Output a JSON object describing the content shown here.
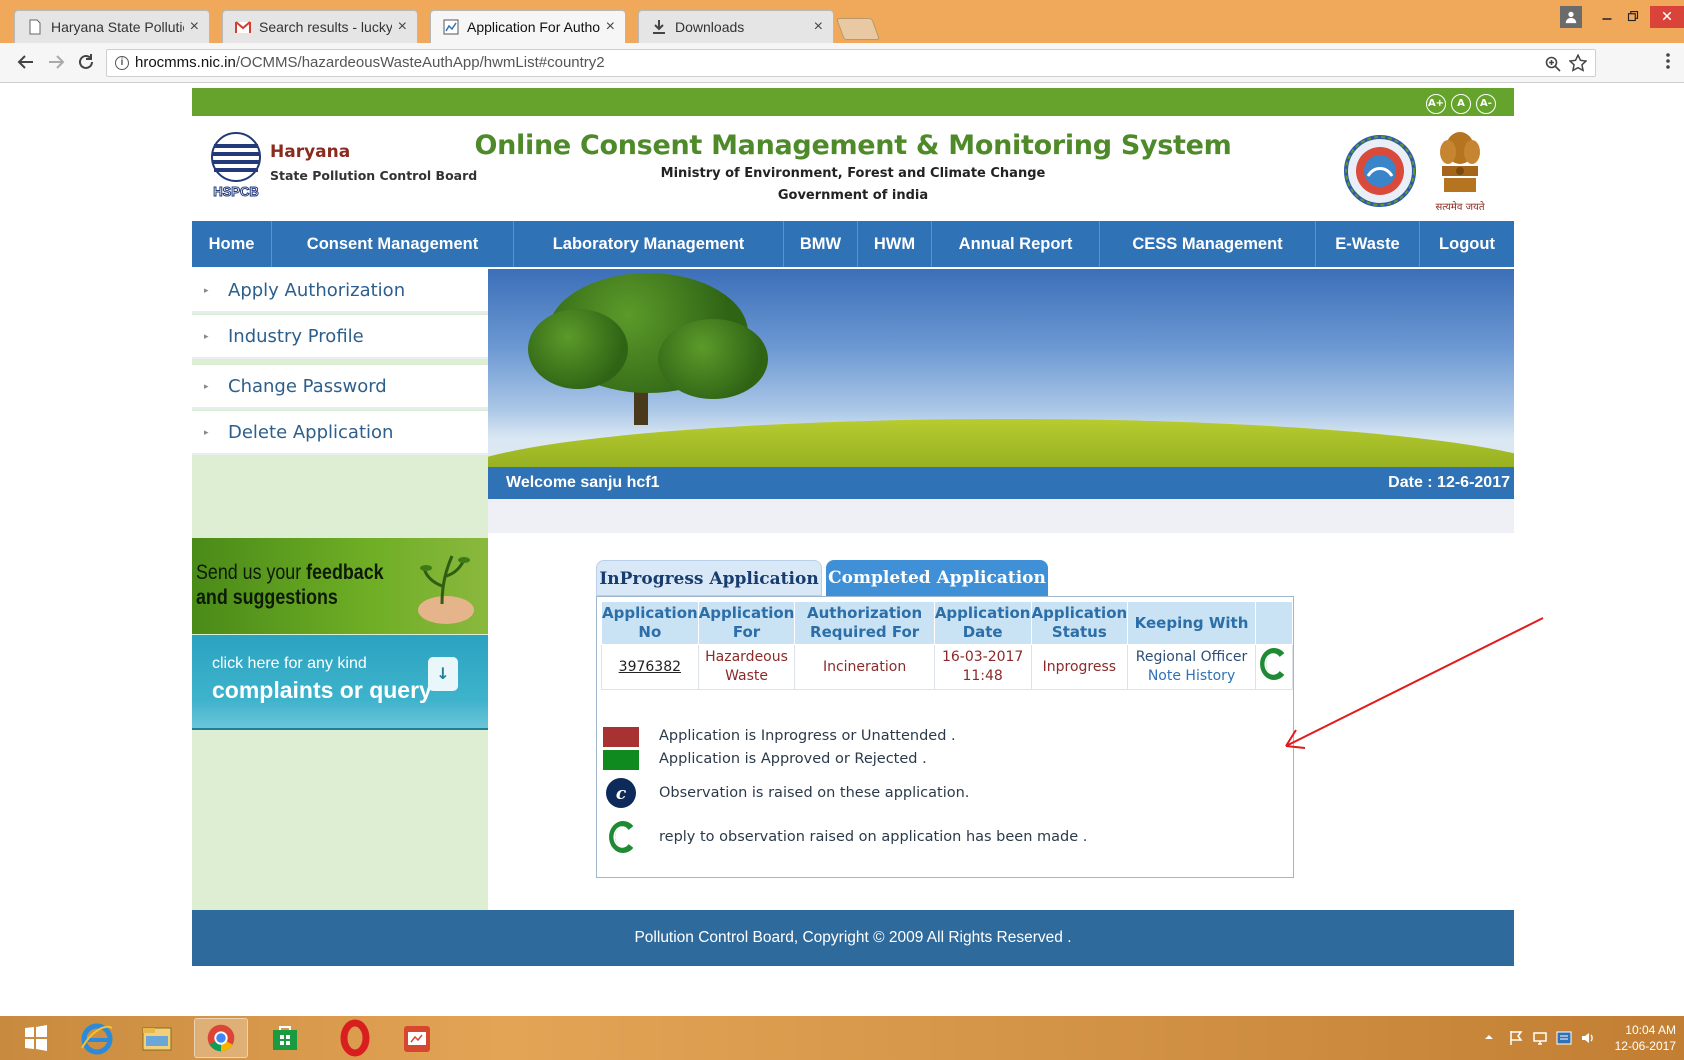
{
  "browser": {
    "tabs": [
      {
        "label": "Haryana State Pollution (",
        "favicon": "page-icon"
      },
      {
        "label": "Search results - luckysan",
        "favicon": "gmail-icon"
      },
      {
        "label": "Application For Authoriz",
        "favicon": "site-icon"
      },
      {
        "label": "Downloads",
        "favicon": "download-icon"
      }
    ],
    "close_glyph": "×",
    "url_host": "hrocmms.nic.in",
    "url_path": "/OCMMS/hazardeousWasteAuthApp/hwmList#country2"
  },
  "site": {
    "font_controls": [
      "A+",
      "A",
      "A-"
    ],
    "org_name": "Haryana",
    "org_sub": "State Pollution Control Board",
    "logo_caption": "HSPCB",
    "title": "Online Consent Management & Monitoring System",
    "ministry": "Ministry of Environment, Forest and Climate Change",
    "government": "Government of india",
    "emblem_caption": "सत्यमेव जयते"
  },
  "nav": [
    {
      "label": "Home"
    },
    {
      "label": "Consent Management"
    },
    {
      "label": "Laboratory Management"
    },
    {
      "label": "BMW"
    },
    {
      "label": "HWM"
    },
    {
      "label": "Annual Report"
    },
    {
      "label": "CESS Management"
    },
    {
      "label": "E-Waste"
    },
    {
      "label": "Logout"
    }
  ],
  "sidebar": {
    "items": [
      {
        "label": "Apply Authorization"
      },
      {
        "label": "Industry Profile"
      },
      {
        "label": "Change Password"
      },
      {
        "label": "Delete Application"
      }
    ],
    "feedback_line1_pre": "Send us your ",
    "feedback_line1_bold": "feedback",
    "feedback_line2": "and suggestions",
    "complaints_line1": "click here for any kind",
    "complaints_line2": "complaints or query"
  },
  "welcome": {
    "text": "Welcome sanju hcf1",
    "date": "Date : 12-6-2017"
  },
  "app_tabs": {
    "inprogress": "InProgress Application",
    "completed": "Completed Application"
  },
  "table": {
    "headers": [
      "Application No",
      "Application For",
      "Authorization Required For",
      "Application Date",
      "Application Status",
      "Keeping With"
    ],
    "rows": [
      {
        "app_no": "3976382",
        "app_for": "Hazardeous Waste",
        "auth_for": "Incineration",
        "date": "16-03-2017 11:48",
        "status": "Inprogress",
        "keeping": "Regional Officer",
        "keeping_link": "Note History"
      }
    ]
  },
  "legend": [
    {
      "text": "Application is Inprogress or Unattended .",
      "color": "#a83232"
    },
    {
      "text": "Application is Approved or Rejected .",
      "color": "#0f8a1e"
    },
    {
      "text": "Observation is raised on these application.",
      "icon": "observation-c-icon"
    },
    {
      "text": "reply to observation raised on application has been made .",
      "icon": "reply-c-icon"
    }
  ],
  "footer": {
    "text": "Pollution Control Board, Copyright © 2009 All Rights Reserved ."
  },
  "taskbar": {
    "time": "10:04 AM",
    "date": "12-06-2017"
  },
  "colors": {
    "nav_blue": "#2f72b5",
    "header_green": "#65a32d",
    "title_green": "#4f8a2a",
    "org_red": "#8b2a1e"
  }
}
